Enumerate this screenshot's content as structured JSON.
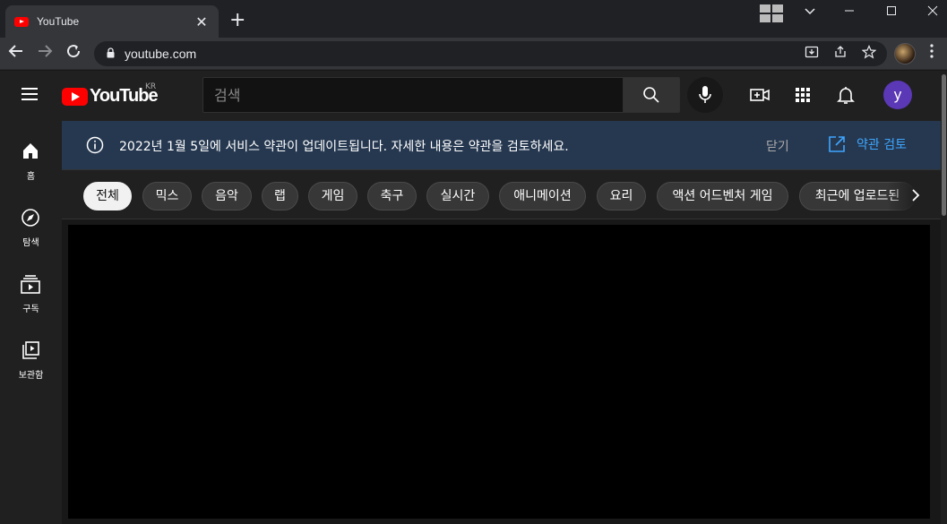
{
  "browser": {
    "tab_title": "YouTube",
    "tab_close": "✕",
    "new_tab": "+",
    "url": "youtube.com"
  },
  "youtube": {
    "logo_text": "YouTube",
    "region": "KR",
    "search_placeholder": "검색",
    "avatar_letter": "y",
    "sidebar": [
      {
        "label": "홈",
        "icon": "home-icon"
      },
      {
        "label": "탐색",
        "icon": "compass-icon"
      },
      {
        "label": "구독",
        "icon": "subscriptions-icon"
      },
      {
        "label": "보관함",
        "icon": "library-icon"
      }
    ],
    "banner": {
      "text": "2022년 1월 5일에 서비스 약관이 업데이트됩니다. 자세한 내용은 약관을 검토하세요.",
      "close": "닫기",
      "review": "약관 검토"
    },
    "chips": [
      "전체",
      "믹스",
      "음악",
      "랩",
      "게임",
      "축구",
      "실시간",
      "애니메이션",
      "요리",
      "액션 어드벤처 게임",
      "최근에 업로드된"
    ]
  },
  "colors": {
    "accent_link": "#3ea6ff",
    "brand_red": "#ff0000",
    "banner_bg": "#263850",
    "avatar_bg": "#5b38b5"
  }
}
